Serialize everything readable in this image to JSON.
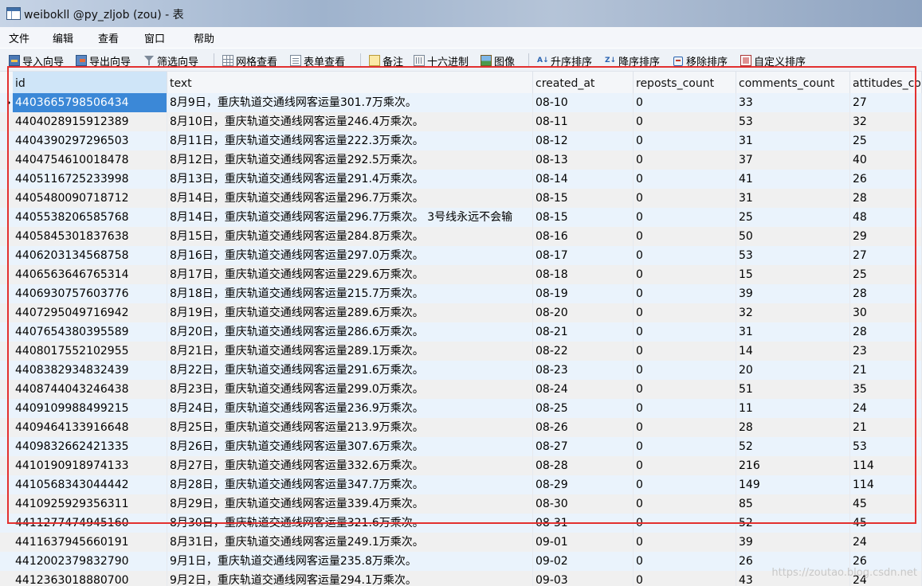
{
  "window": {
    "title": "weibokll @py_zljob (zou) - 表"
  },
  "menu": [
    "文件",
    "编辑",
    "查看",
    "窗口",
    "帮助"
  ],
  "toolbar": [
    {
      "label": "导入向导",
      "icon": "import-wizard-icon"
    },
    {
      "label": "导出向导",
      "icon": "export-wizard-icon"
    },
    {
      "label": "筛选向导",
      "icon": "filter-icon"
    },
    {
      "label": "网格查看",
      "icon": "grid-view-icon"
    },
    {
      "label": "表单查看",
      "icon": "form-view-icon"
    },
    {
      "label": "备注",
      "icon": "memo-icon"
    },
    {
      "label": "十六进制",
      "icon": "hex-icon"
    },
    {
      "label": "图像",
      "icon": "image-icon"
    },
    {
      "label": "升序排序",
      "icon": "sort-ascending-icon"
    },
    {
      "label": "降序排序",
      "icon": "sort-descending-icon"
    },
    {
      "label": "移除排序",
      "icon": "remove-sort-icon"
    },
    {
      "label": "自定义排序",
      "icon": "custom-sort-icon"
    }
  ],
  "table": {
    "columns": [
      "id",
      "text",
      "created_at",
      "reposts_count",
      "comments_count",
      "attitudes_co"
    ],
    "rows": [
      [
        "4403665798506434",
        "8月9日，重庆轨道交通线网客运量301.7万乘次。",
        "08-10",
        "0",
        "33",
        "27"
      ],
      [
        "4404028915912389",
        "8月10日，重庆轨道交通线网客运量246.4万乘次。",
        "08-11",
        "0",
        "53",
        "32"
      ],
      [
        "4404390297296503",
        "8月11日，重庆轨道交通线网客运量222.3万乘次。",
        "08-12",
        "0",
        "31",
        "25"
      ],
      [
        "4404754610018478",
        "8月12日，重庆轨道交通线网客运量292.5万乘次。",
        "08-13",
        "0",
        "37",
        "40"
      ],
      [
        "4405116725233998",
        "8月13日，重庆轨道交通线网客运量291.4万乘次。",
        "08-14",
        "0",
        "41",
        "26"
      ],
      [
        "4405480090718712",
        "8月14日，重庆轨道交通线网客运量296.7万乘次。",
        "08-15",
        "0",
        "31",
        "28"
      ],
      [
        "4405538206585768",
        "8月14日，重庆轨道交通线网客运量296.7万乘次。 3号线永远不会输",
        "08-15",
        "0",
        "25",
        "48"
      ],
      [
        "4405845301837638",
        "8月15日，重庆轨道交通线网客运量284.8万乘次。",
        "08-16",
        "0",
        "50",
        "29"
      ],
      [
        "4406203134568758",
        "8月16日，重庆轨道交通线网客运量297.0万乘次。",
        "08-17",
        "0",
        "53",
        "27"
      ],
      [
        "4406563646765314",
        "8月17日，重庆轨道交通线网客运量229.6万乘次。",
        "08-18",
        "0",
        "15",
        "25"
      ],
      [
        "4406930757603776",
        "8月18日，重庆轨道交通线网客运量215.7万乘次。",
        "08-19",
        "0",
        "39",
        "28"
      ],
      [
        "4407295049716942",
        "8月19日，重庆轨道交通线网客运量289.6万乘次。",
        "08-20",
        "0",
        "32",
        "30"
      ],
      [
        "4407654380395589",
        "8月20日，重庆轨道交通线网客运量286.6万乘次。",
        "08-21",
        "0",
        "31",
        "28"
      ],
      [
        "4408017552102955",
        "8月21日，重庆轨道交通线网客运量289.1万乘次。",
        "08-22",
        "0",
        "14",
        "23"
      ],
      [
        "4408382934832439",
        "8月22日，重庆轨道交通线网客运量291.6万乘次。",
        "08-23",
        "0",
        "20",
        "21"
      ],
      [
        "4408744043246438",
        "8月23日，重庆轨道交通线网客运量299.0万乘次。",
        "08-24",
        "0",
        "51",
        "35"
      ],
      [
        "4409109988499215",
        "8月24日，重庆轨道交通线网客运量236.9万乘次。",
        "08-25",
        "0",
        "11",
        "24"
      ],
      [
        "4409464133916648",
        "8月25日，重庆轨道交通线网客运量213.9万乘次。",
        "08-26",
        "0",
        "28",
        "21"
      ],
      [
        "4409832662421335",
        "8月26日，重庆轨道交通线网客运量307.6万乘次。",
        "08-27",
        "0",
        "52",
        "53"
      ],
      [
        "4410190918974133",
        "8月27日，重庆轨道交通线网客运量332.6万乘次。",
        "08-28",
        "0",
        "216",
        "114"
      ],
      [
        "4410568343044442",
        "8月28日，重庆轨道交通线网客运量347.7万乘次。",
        "08-29",
        "0",
        "149",
        "114"
      ],
      [
        "4410925929356311",
        "8月29日，重庆轨道交通线网客运量339.4万乘次。",
        "08-30",
        "0",
        "85",
        "45"
      ],
      [
        "4411277474945160",
        "8月30日，重庆轨道交通线网客运量321.6万乘次。",
        "08-31",
        "0",
        "52",
        "45"
      ],
      [
        "4411637945660191",
        "8月31日，重庆轨道交通线网客运量249.1万乘次。",
        "09-01",
        "0",
        "39",
        "24"
      ],
      [
        "4412002379832790",
        "9月1日，重庆轨道交通线网客运量235.8万乘次。",
        "09-02",
        "0",
        "26",
        "26"
      ],
      [
        "4412363018880700",
        "9月2日，重庆轨道交通线网客运量294.1万乘次。",
        "09-03",
        "0",
        "43",
        "24"
      ]
    ]
  },
  "watermark": "https://zoutao.blog.csdn.net",
  "colors": {
    "selection": "#3b88d7",
    "highlight_frame": "#e3302f"
  }
}
